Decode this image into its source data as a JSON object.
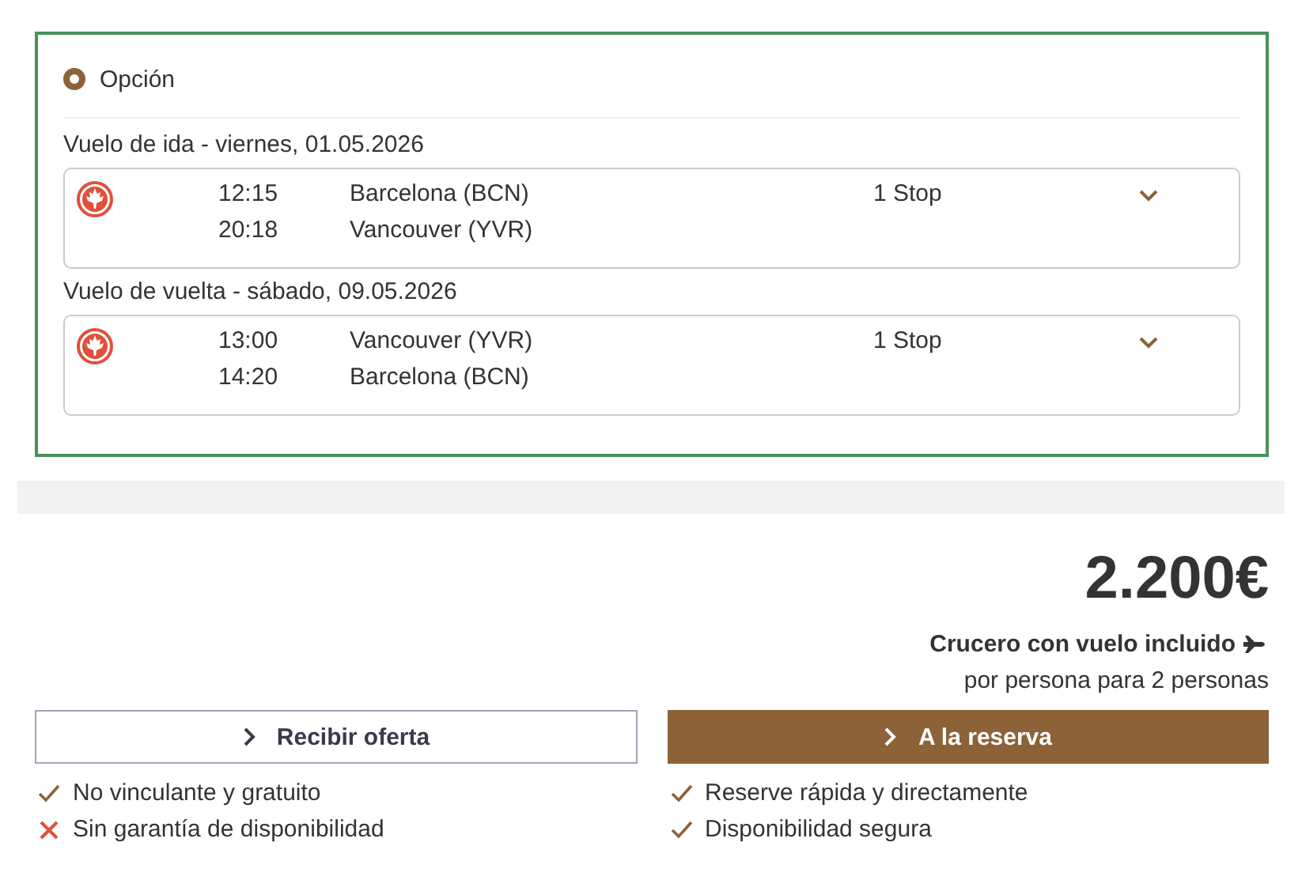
{
  "option": {
    "label": "Opción",
    "selected": true
  },
  "flights": [
    {
      "heading": "Vuelo de ida - viernes, 01.05.2026",
      "expanded": false,
      "stops": "1 Stop",
      "segments": [
        {
          "time": "12:15",
          "place": "Barcelona (BCN)"
        },
        {
          "time": "20:18",
          "place": "Vancouver (YVR)"
        }
      ]
    },
    {
      "heading": "Vuelo de vuelta - sábado, 09.05.2026",
      "expanded": false,
      "stops": "1 Stop",
      "segments": [
        {
          "time": "13:00",
          "place": "Vancouver (YVR)"
        },
        {
          "time": "14:20",
          "place": "Barcelona (BCN)"
        }
      ]
    }
  ],
  "price": {
    "amount": "2.200€",
    "title": "Crucero con vuelo incluido",
    "note": "por persona para 2 personas"
  },
  "actions": [
    {
      "label": "Recibir oferta",
      "kind": "outline",
      "features": [
        {
          "text": "No vinculante y gratuito",
          "kind": "check"
        },
        {
          "text": "Sin garantía de disponibilidad",
          "kind": "cross"
        }
      ]
    },
    {
      "label": "A la reserva",
      "kind": "primary",
      "features": [
        {
          "text": "Reserve rápida y directamente",
          "kind": "check"
        },
        {
          "text": "Disponibilidad segura",
          "kind": "check"
        }
      ]
    }
  ]
}
